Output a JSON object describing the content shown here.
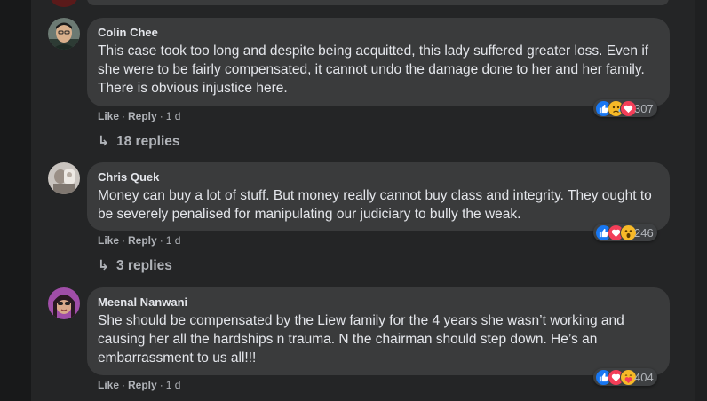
{
  "comments": [
    {
      "author": "Colin Chee",
      "text": "This case took too long and despite being acquitted, this lady suffered greater loss. Even if she were to be fairly compensated, it cannot undo the damage done to her and her family. There is obvious injustice here.",
      "like_label": "Like",
      "reply_label": "Reply",
      "time": "1 d",
      "reaction_count": "307",
      "reactions": [
        "like",
        "sad",
        "love"
      ],
      "replies_label": "18 replies"
    },
    {
      "author": "Chris Quek",
      "text": "Money can buy a lot of stuff. But money really cannot buy class and integrity. They ought to be severely penalised for manipulating our judiciary to bully the weak.",
      "like_label": "Like",
      "reply_label": "Reply",
      "time": "1 d",
      "reaction_count": "246",
      "reactions": [
        "like",
        "love",
        "wow"
      ],
      "replies_label": "3 replies"
    },
    {
      "author": "Meenal Nanwani",
      "text": "She should be compensated by the Liew family for the 4 years she wasn’t working and causing her all the hardships n trauma. N the chairman should step down. He’s an embarrassment to us all!!!",
      "like_label": "Like",
      "reply_label": "Reply",
      "time": "1 d",
      "reaction_count": "404",
      "reactions": [
        "like",
        "love",
        "care"
      ]
    }
  ],
  "colors": {
    "page": "#18191a",
    "feed": "#242526",
    "bubble": "#3a3b3c",
    "text": "#e4e6eb",
    "secondary": "#b0b3b8",
    "like": "#1877f2",
    "love": "#f33e58",
    "yellow": "#f7b928"
  }
}
